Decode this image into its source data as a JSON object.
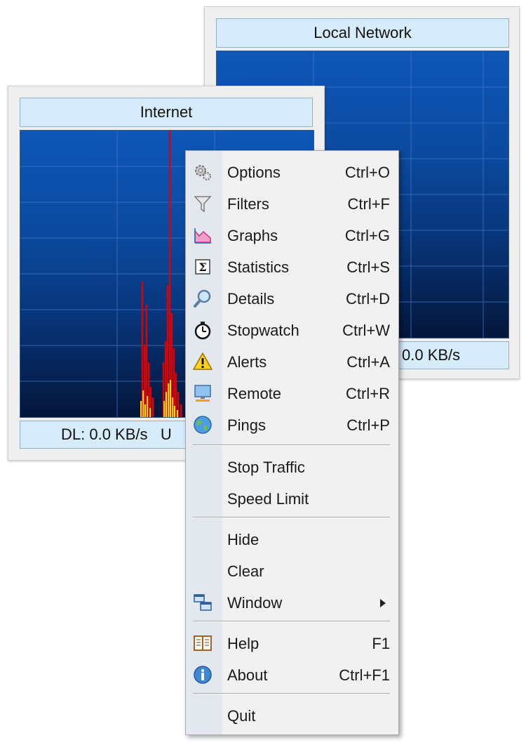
{
  "windows": {
    "local_network": {
      "title": "Local Network",
      "status": "0.0 KB/s"
    },
    "internet": {
      "title": "Internet",
      "status": "DL: 0.0 KB/s   U"
    }
  },
  "menu": {
    "items": [
      {
        "label": "Options",
        "shortcut": "Ctrl+O",
        "icon": "gears-icon"
      },
      {
        "label": "Filters",
        "shortcut": "Ctrl+F",
        "icon": "funnel-icon"
      },
      {
        "label": "Graphs",
        "shortcut": "Ctrl+G",
        "icon": "graph-icon"
      },
      {
        "label": "Statistics",
        "shortcut": "Ctrl+S",
        "icon": "sigma-icon"
      },
      {
        "label": "Details",
        "shortcut": "Ctrl+D",
        "icon": "magnifier-icon"
      },
      {
        "label": "Stopwatch",
        "shortcut": "Ctrl+W",
        "icon": "stopwatch-icon"
      },
      {
        "label": "Alerts",
        "shortcut": "Ctrl+A",
        "icon": "warning-icon"
      },
      {
        "label": "Remote",
        "shortcut": "Ctrl+R",
        "icon": "monitor-icon"
      },
      {
        "label": "Pings",
        "shortcut": "Ctrl+P",
        "icon": "globe-icon"
      },
      {
        "label": "Stop Traffic"
      },
      {
        "label": "Speed Limit"
      },
      {
        "label": "Hide"
      },
      {
        "label": "Clear"
      },
      {
        "label": "Window",
        "icon": "windows-icon",
        "submenu": true
      },
      {
        "label": "Help",
        "shortcut": "F1",
        "icon": "help-book-icon"
      },
      {
        "label": "About",
        "shortcut": "Ctrl+F1",
        "icon": "info-icon"
      },
      {
        "label": "Quit"
      }
    ]
  },
  "colors": {
    "graph_download": "#e00000",
    "graph_upload": "#ffe800",
    "header_bg": "#d6ecfb",
    "graph_bg_top": "#0e56b8",
    "graph_bg_bottom": "#04163a"
  }
}
